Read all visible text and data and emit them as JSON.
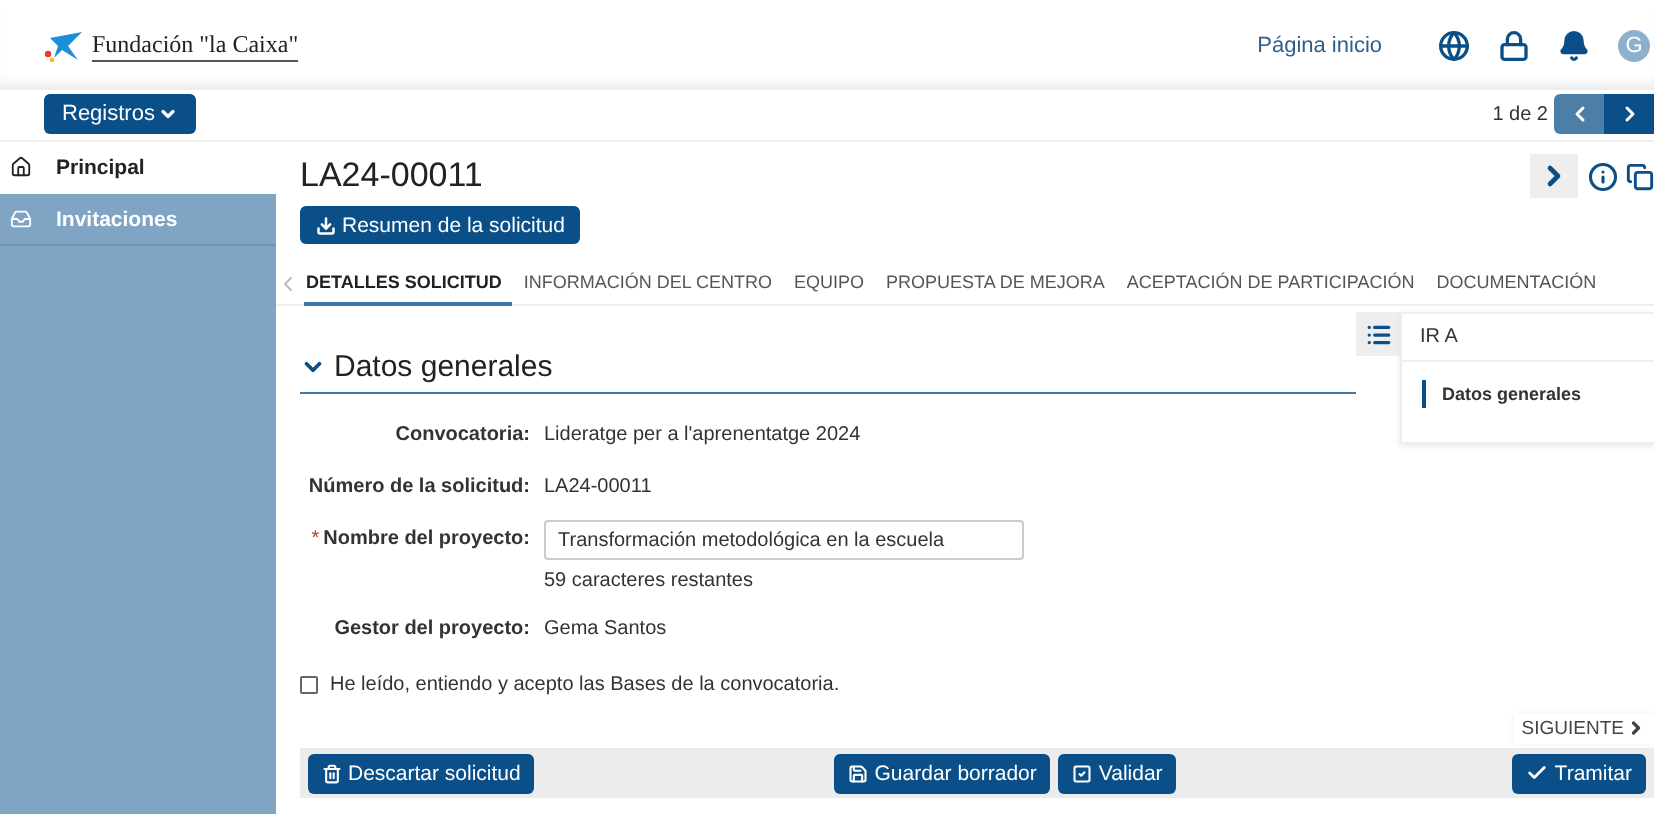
{
  "header": {
    "logo_text": "Fundación \"la Caixa\"",
    "home_link": "Página inicio",
    "avatar": "G"
  },
  "toolbar": {
    "menu_button": "Registros",
    "pagination": "1 de 2"
  },
  "sidebar": {
    "items": [
      {
        "label": "Principal",
        "selected": true
      },
      {
        "label": "Invitaciones",
        "selected": false
      }
    ]
  },
  "page": {
    "title": "LA24-00011",
    "summary_button": "Resumen de la solicitud"
  },
  "tabs": [
    {
      "label": "DETALLES SOLICITUD",
      "selected": true
    },
    {
      "label": "INFORMACIÓN DEL CENTRO",
      "selected": false
    },
    {
      "label": "EQUIPO",
      "selected": false
    },
    {
      "label": "PROPUESTA DE MEJORA",
      "selected": false
    },
    {
      "label": "ACEPTACIÓN DE PARTICIPACIÓN",
      "selected": false
    },
    {
      "label": "DOCUMENTACIÓN",
      "selected": false
    }
  ],
  "section": {
    "title": "Datos generales",
    "expanded": true
  },
  "fields": [
    {
      "kind": "text",
      "label": "Convocatoria:",
      "value": "Lideratge per a l'aprenentatge 2024"
    },
    {
      "kind": "text",
      "label": "Número de la solicitud:",
      "value": "LA24-00011"
    },
    {
      "kind": "input",
      "label": "Nombre del proyecto:",
      "value": "Transformación metodológica en la escuela",
      "hint": "59 caracteres restantes",
      "required": true
    },
    {
      "kind": "text",
      "label": "Gestor del proyecto:",
      "value": "Gema Santos"
    }
  ],
  "required_mark": "*",
  "agreement": {
    "label": "He leído, entiendo y acepto las Bases de la convocatoria.",
    "checked": false
  },
  "go_to": {
    "title": "IR A",
    "items": [
      {
        "label": "Datos generales",
        "selected": true
      }
    ]
  },
  "next_link": "SIGUIENTE",
  "footer": {
    "discard": "Descartar solicitud",
    "save": "Guardar borrador",
    "validate": "Validar",
    "submit": "Tramitar"
  }
}
